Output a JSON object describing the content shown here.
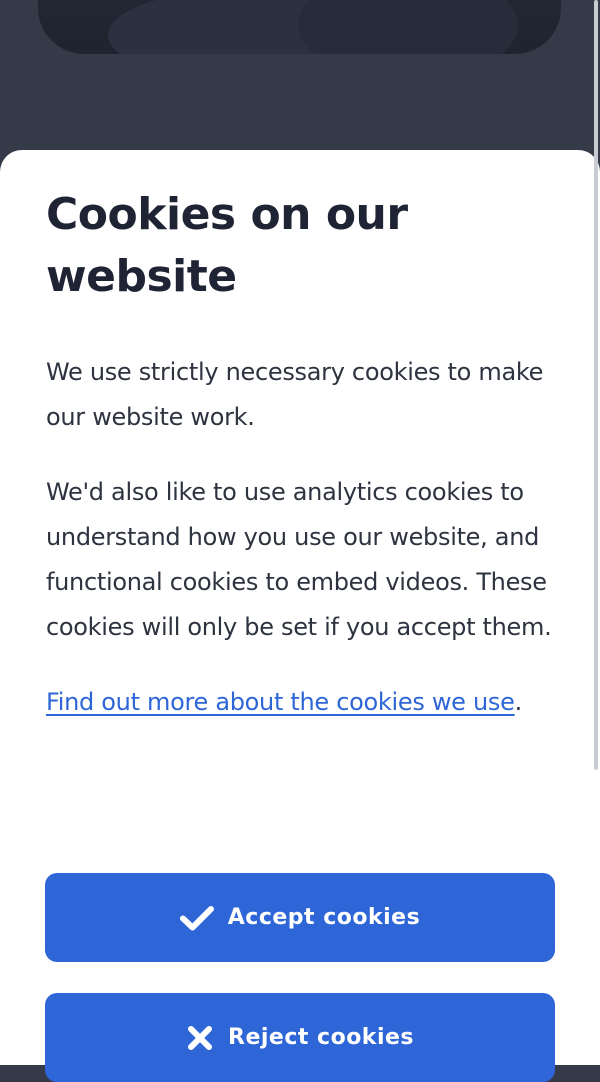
{
  "cookie_banner": {
    "title": "Cookies on our website",
    "paragraph_1": "We use strictly necessary cookies to make our website work.",
    "paragraph_2": "We'd also like to use analytics cookies to understand how you use our website, and functional cookies to embed videos. These cookies will only be set if you accept them.",
    "more_link": "Find out more about the cookies we use",
    "more_suffix": ".",
    "accept_label": "Accept cookies",
    "reject_label": "Reject cookies",
    "accept_icon": "checkmark-icon",
    "reject_icon": "close-icon"
  },
  "colors": {
    "accent": "#2f66d7",
    "overlay": "#343a48",
    "text": "#2e3340",
    "heading": "#1f2434"
  }
}
